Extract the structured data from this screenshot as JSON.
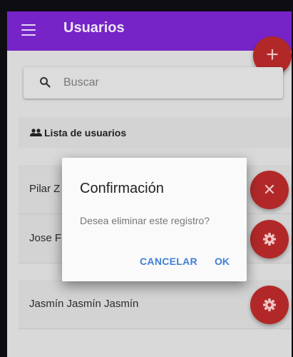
{
  "app_bar": {
    "title": "Usuarios",
    "menu_icon": "hamburger-menu-icon",
    "add_icon": "plus-icon",
    "color": "#7624c7"
  },
  "search": {
    "placeholder": "Buscar",
    "value": "",
    "icon": "search-icon"
  },
  "list": {
    "header_label": "Lista de usuarios",
    "header_icon": "people-icon",
    "items": [
      {
        "label": "Pilar Z",
        "action_icon": "close-icon"
      },
      {
        "label": "Jose F",
        "action_icon": "gear-icon"
      },
      {
        "label": "Jasmín Jasmín Jasmín",
        "action_icon": "gear-icon"
      }
    ]
  },
  "dialog": {
    "title": "Confirmación",
    "message": "Desea eliminar este registro?",
    "cancel_label": "CANCELAR",
    "ok_label": "OK",
    "accent": "#3f7fd6"
  },
  "colors": {
    "fab": "#b22828",
    "overlay_bg": "#d9d9d9"
  }
}
